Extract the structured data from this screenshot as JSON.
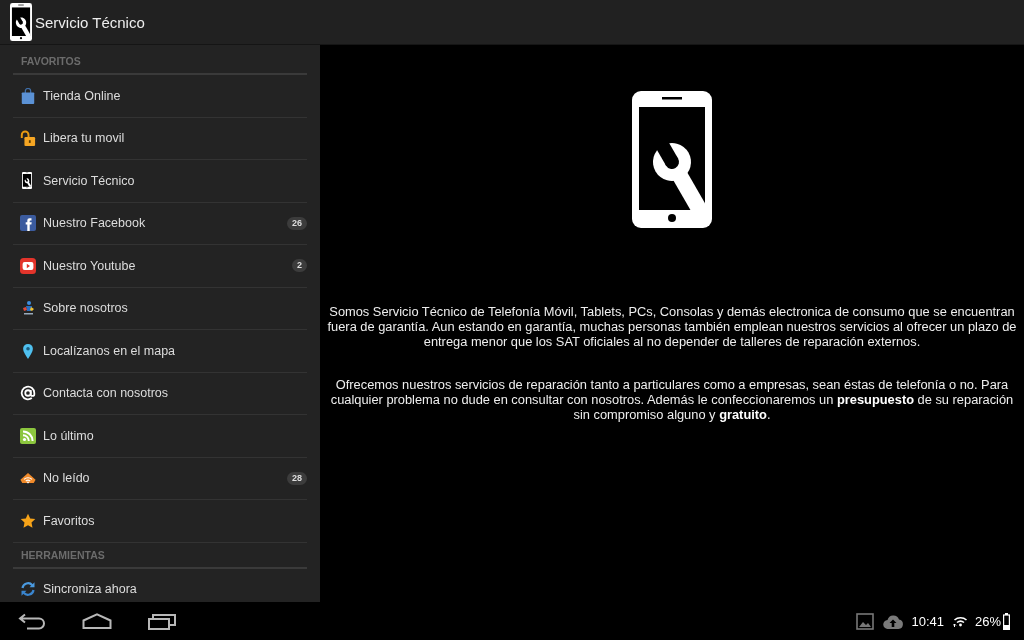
{
  "action_bar": {
    "title": "Servicio Técnico"
  },
  "drawer": {
    "sections": [
      {
        "heading": "FAVORITOS",
        "items": [
          {
            "kind": "store",
            "label": "Tienda Online"
          },
          {
            "kind": "unlock",
            "label": "Libera tu movil"
          },
          {
            "kind": "service",
            "label": "Servicio Técnico"
          },
          {
            "kind": "facebook",
            "label": "Nuestro Facebook",
            "count": "26"
          },
          {
            "kind": "youtube",
            "label": "Nuestro Youtube",
            "count": "2"
          },
          {
            "kind": "about",
            "label": "Sobre nosotros"
          },
          {
            "kind": "map",
            "label": "Localízanos en el mapa"
          },
          {
            "kind": "contact",
            "label": "Contacta con nosotros"
          },
          {
            "kind": "feed",
            "label": "Lo último"
          },
          {
            "kind": "unread",
            "label": "No leído",
            "count": "28"
          },
          {
            "kind": "favorites",
            "label": "Favoritos"
          }
        ]
      },
      {
        "heading": "HERRAMIENTAS",
        "items": [
          {
            "kind": "sync",
            "label": "Sincroniza ahora"
          }
        ]
      }
    ]
  },
  "content": {
    "paragraphs": [
      "Somos Servicio Técnico de Telefonía Móvil, Tablets, PCs, Consolas y demás electronica de consumo que se encuentran fuera de garantía. Aun estando en garantía, muchas personas también emplean nuestros servicios al ofrecer un plazo de entrega menor que los SAT oficiales al no depender de talleres de reparación externos.",
      "Ofrecemos nuestros servicios de reparación tanto a particulares como a empresas, sean éstas de telefonía o no. Para cualquier problema no dude en consultar con nosotros. Además le confeccionaremos un **presupuesto** de su reparación sin compromiso alguno y **gratuito**."
    ]
  },
  "status_bar": {
    "time": "10:41",
    "battery": "26%"
  }
}
